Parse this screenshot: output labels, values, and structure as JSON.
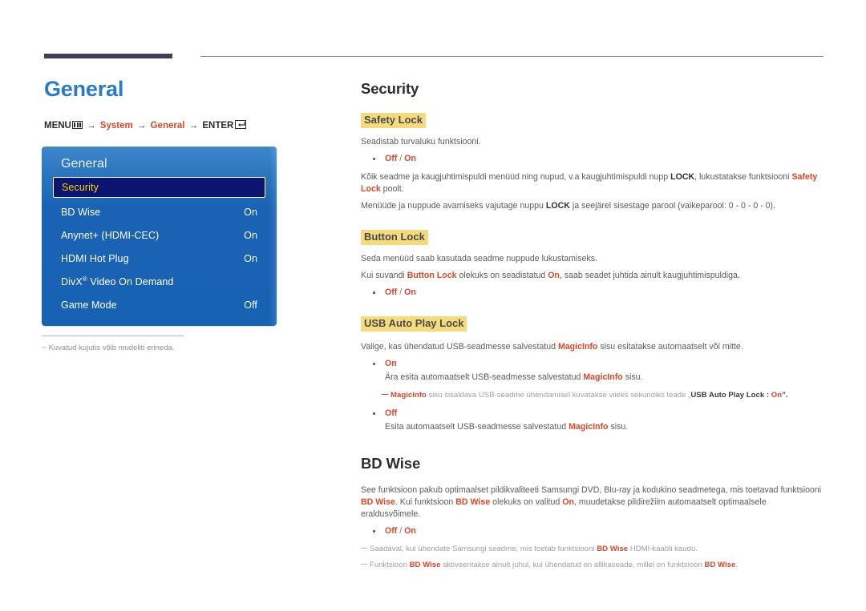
{
  "page": {
    "title": "General",
    "breadcrumb": {
      "menu_label": "MENU",
      "arrow": "→",
      "step1": "System",
      "step2": "General",
      "enter_label": "ENTER"
    },
    "footnote": "Kuvatud kujutis võib mudeliti erineda.",
    "footnote_dash": "−"
  },
  "osd": {
    "title": "General",
    "rows": [
      {
        "label": "Security",
        "value": "",
        "selected": true
      },
      {
        "label": "BD Wise",
        "value": "On",
        "selected": false
      },
      {
        "label": "Anynet+ (HDMI-CEC)",
        "value": "On",
        "selected": false
      },
      {
        "label": "HDMI Hot Plug",
        "value": "On",
        "selected": false
      },
      {
        "label": "DivX",
        "label_sup": "®",
        "label_rest": " Video On Demand",
        "value": "",
        "selected": false
      },
      {
        "label": "Game Mode",
        "value": "Off",
        "selected": false
      }
    ]
  },
  "security": {
    "heading": "Security",
    "safety_lock": {
      "title": "Safety Lock",
      "desc": "Seadistab turvaluku funktsiooni.",
      "option_off": "Off",
      "option_slash": " / ",
      "option_on": "On",
      "para1_a": "Kõik seadme ja kaugjuhtimispuldi menüüd ning nupud, v.a kaugjuhtimispuldi nupp ",
      "para1_lock": "LOCK",
      "para1_b": ", lukustatakse funktsiooni ",
      "para1_safety": "Safety Lock",
      "para1_c": " poolt.",
      "para2_a": "Menüüde ja nuppude avamiseks vajutage nuppu ",
      "para2_lock": "LOCK",
      "para2_b": " ja seejärel sisestage parool (vaikeparool: 0 - 0 - 0 - 0)."
    },
    "button_lock": {
      "title": "Button Lock",
      "desc1": "Seda menüüd saab kasutada seadme nuppude lukustamiseks.",
      "desc2_a": "Kui suvandi ",
      "desc2_name": "Button Lock",
      "desc2_b": " olekuks on seadistatud ",
      "desc2_on": "On",
      "desc2_c": ", saab seadet juhtida ainult kaugjuhtimispuldiga.",
      "option_off": "Off",
      "option_slash": " / ",
      "option_on": "On"
    },
    "usb_auto_play_lock": {
      "title": "USB Auto Play Lock",
      "desc_a": "Valige, kas ühendatud USB-seadmesse salvestatud ",
      "desc_magicinfo": "MagicInfo",
      "desc_b": " sisu esitatakse automaatselt või mitte.",
      "opt_on": "On",
      "opt_on_desc_a": "Ära esita automaatselt USB-seadmesse salvestatud ",
      "opt_on_desc_magicinfo": "MagicInfo",
      "opt_on_desc_b": " sisu.",
      "note_magicinfo": "MagicInfo",
      "note_a": " sisu sisaldava USB-seadme ühendamisel kuvatakse viieks sekundiks teade „",
      "note_bold": "USB Auto Play Lock",
      "note_colon": " : ",
      "note_on": "On",
      "note_end": "”.",
      "opt_off": "Off",
      "opt_off_desc_a": "Esita automaatselt USB-seadmesse salvestatud ",
      "opt_off_desc_magicinfo": "MagicInfo",
      "opt_off_desc_b": " sisu."
    }
  },
  "bd_wise": {
    "heading": "BD Wise",
    "para_a": "See funktsioon pakub optimaalset pildikvaliteeti Samsungi DVD, Blu-ray ja kodukino seadmetega, mis toetavad funktsiooni ",
    "para_name1": "BD Wise",
    "para_b": ". Kui funktsioon ",
    "para_name2": "BD Wise",
    "para_c": " olekuks on valitud ",
    "para_on": "On",
    "para_d": ", muudetakse pildirežiim automaatselt optimaalsele eraldusvõimele.",
    "option_off": "Off",
    "option_slash": " / ",
    "option_on": "On",
    "note1_a": "Saadaval, kui ühendate Samsungi seadme, mis toetab funktsiooni ",
    "note1_name": "BD Wise",
    "note1_b": " HDMI-kaabli kaudu.",
    "note2_a": "Funktsioon ",
    "note2_name1": "BD Wise",
    "note2_b": " aktiveeritakse ainult juhul, kui ühendatud on allikaseade, millel on funktsioon ",
    "note2_name2": "BD Wise",
    "note2_c": "."
  },
  "colors": {
    "accent_blue": "#2b7cc4",
    "accent_red": "#d9482b",
    "highlight_yellow": "#f6db7e",
    "osd_blue": "#1862b3",
    "osd_selected": "#0b1570",
    "osd_selected_text": "#ffd200",
    "rule_purple": "#453d54"
  }
}
